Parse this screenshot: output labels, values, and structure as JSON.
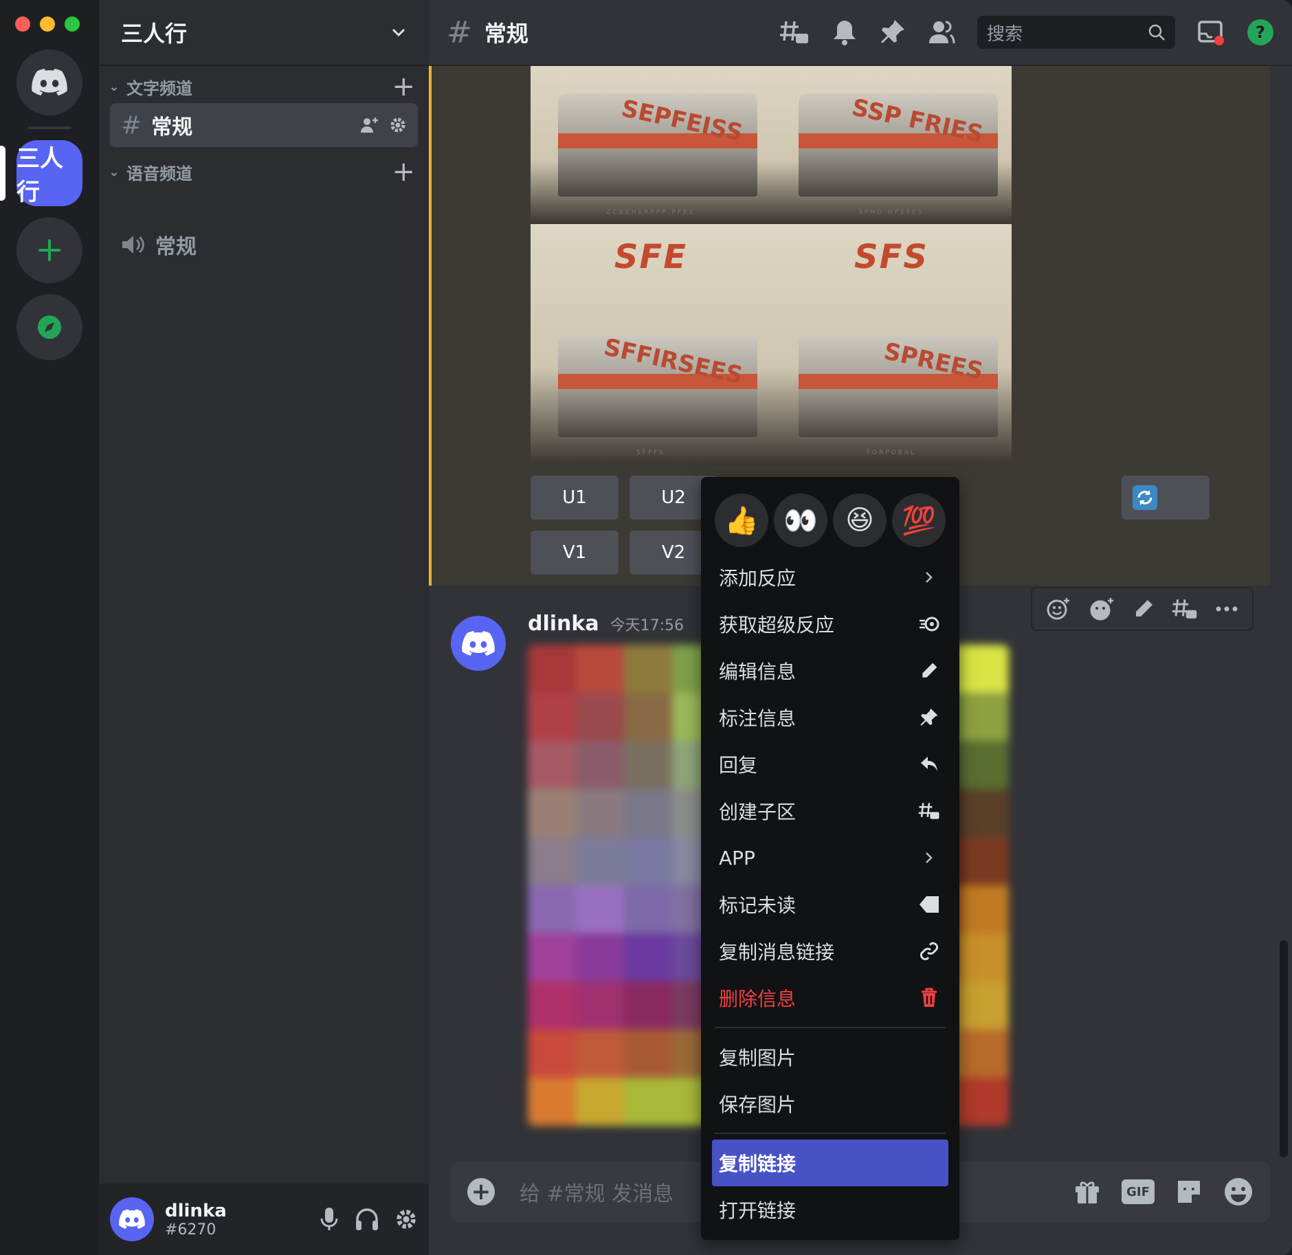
{
  "server": {
    "name": "三人行",
    "rail_label": "三人行"
  },
  "sidebar": {
    "text_category": "文字频道",
    "voice_category": "语音频道",
    "text_channel": "常规",
    "voice_channel": "常规"
  },
  "user": {
    "name": "dlinka",
    "tag": "#6270"
  },
  "topbar": {
    "channel": "常规",
    "search_placeholder": "搜索"
  },
  "art": {
    "cells": [
      {
        "lettering": "",
        "train_text": "SEPFEISS",
        "caption": "ZCBEHERPPP PFEE"
      },
      {
        "lettering": "",
        "train_text": "SSP FRIES",
        "caption": "SPHO HPEFES"
      },
      {
        "lettering": "SFE",
        "train_text": "SFFIRSEES",
        "caption": "SFFFS"
      },
      {
        "lettering": "SFS",
        "train_text": "SPREES",
        "caption": "FORPOBAL"
      }
    ]
  },
  "buttons": {
    "u1": "U1",
    "u2": "U2",
    "v1": "V1",
    "v2": "V2"
  },
  "message2": {
    "author": "dlinka",
    "time": "今天17:56"
  },
  "composer": {
    "placeholder": "给 #常规 发消息",
    "gif": "GIF"
  },
  "context_menu": {
    "reactions": [
      "👍",
      "👀",
      "😆",
      "💯"
    ],
    "items": [
      {
        "label": "添加反应",
        "icon": "chevron-right-icon"
      },
      {
        "label": "获取超级反应",
        "icon": "super-reaction-icon"
      },
      {
        "label": "编辑信息",
        "icon": "pencil-icon"
      },
      {
        "label": "标注信息",
        "icon": "pin-icon"
      },
      {
        "label": "回复",
        "icon": "reply-icon"
      },
      {
        "label": "创建子区",
        "icon": "thread-icon"
      },
      {
        "label": "APP",
        "icon": "chevron-right-icon"
      },
      {
        "label": "标记未读",
        "icon": "mark-unread-icon"
      },
      {
        "label": "复制消息链接",
        "icon": "link-icon"
      },
      {
        "label": "删除信息",
        "icon": "trash-icon"
      }
    ],
    "image_items": [
      "复制图片",
      "保存图片"
    ],
    "link_items": [
      "复制链接",
      "打开链接"
    ]
  },
  "colors": {
    "accent": "#5865f2",
    "danger": "#f23f43",
    "highlight_border": "#f0b232",
    "selected": "#4752c4"
  }
}
